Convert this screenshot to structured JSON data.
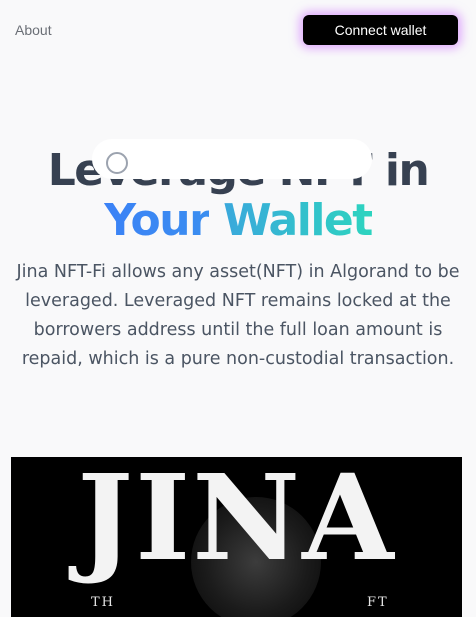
{
  "nav": {
    "about_label": "About",
    "connect_label": "Connect wallet"
  },
  "hero": {
    "title_line1": "Leverage NFT in",
    "title_word_your": "Your",
    "title_word_wallet": "Wallet",
    "description": "Jina NFT-Fi allows any asset(NFT) in Algorand to be leveraged. Leveraged NFT remains locked at the borrowers address until the full loan amount is repaid, which is a pure non-custodial transaction."
  },
  "video": {
    "logo_text": "JINA",
    "tagline_left_fragment": "TH",
    "tagline_right_fragment": "FT"
  },
  "colors": {
    "accent_glow": "#c65fff",
    "gradient_blue": "#3b82f6",
    "gradient_teal": "#2dd4bf",
    "heading": "#374151"
  }
}
